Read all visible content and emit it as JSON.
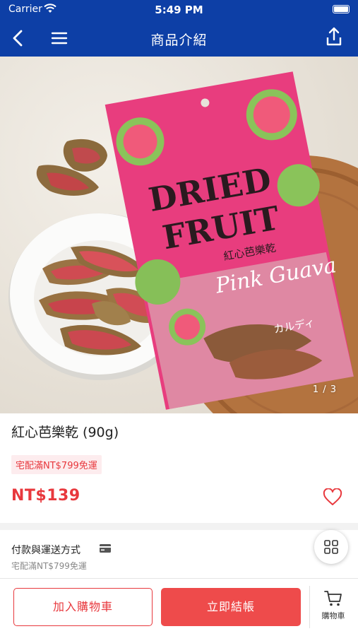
{
  "status_bar": {
    "carrier": "Carrier",
    "time": "5:49 PM"
  },
  "nav": {
    "title": "商品介紹"
  },
  "hero": {
    "pager": "1 / 3",
    "package_text": {
      "line1": "DRIED",
      "line2": "FRUIT",
      "name": "紅心芭樂乾",
      "script": "Pink Guava",
      "brand": "カルディ"
    }
  },
  "product": {
    "name": "紅心芭樂乾 (90g)",
    "promo_tag": "宅配滿NT$799免運",
    "price": "NT$139"
  },
  "payment": {
    "title": "付款與運送方式",
    "subtitle": "宅配滿NT$799免運"
  },
  "actions": {
    "add_to_cart": "加入購物車",
    "checkout": "立即結帳",
    "cart_label": "購物車"
  },
  "colors": {
    "nav": "#0d3fa6",
    "accent": "#e8383d",
    "package": "#e23b7a"
  },
  "icons": [
    "back-arrow-icon",
    "hamburger-menu-icon",
    "share-icon",
    "heart-icon",
    "credit-card-icon",
    "grid-icon",
    "shopping-cart-icon",
    "wifi-icon",
    "battery-icon"
  ]
}
